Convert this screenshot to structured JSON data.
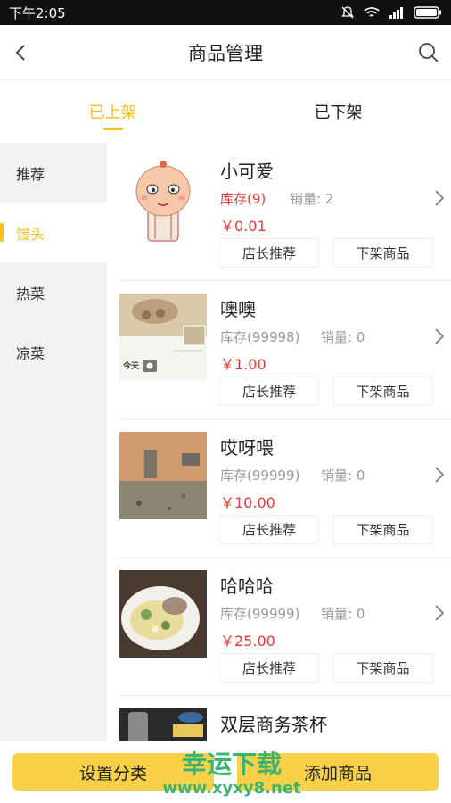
{
  "status": {
    "time": "下午2:05"
  },
  "nav": {
    "title": "商品管理"
  },
  "tabs": [
    {
      "label": "已上架",
      "active": true
    },
    {
      "label": "已下架",
      "active": false
    }
  ],
  "sidebar": {
    "items": [
      {
        "label": "推荐"
      },
      {
        "label": "馒头"
      },
      {
        "label": "热菜"
      },
      {
        "label": "凉菜"
      }
    ]
  },
  "products": [
    {
      "name": "小可爱",
      "stock": "库存(9)",
      "sales": "销量: 2",
      "price": "￥0.01",
      "recommend_label": "店长推荐",
      "offshelf_label": "下架商品"
    },
    {
      "name": "噢噢",
      "stock": "库存(99998)",
      "sales": "销量: 0",
      "price": "￥1.00",
      "recommend_label": "店长推荐",
      "offshelf_label": "下架商品",
      "thumb_text": "今天"
    },
    {
      "name": "哎呀喂",
      "stock": "库存(99999)",
      "sales": "销量: 0",
      "price": "￥10.00",
      "recommend_label": "店长推荐",
      "offshelf_label": "下架商品"
    },
    {
      "name": "哈哈哈",
      "stock": "库存(99999)",
      "sales": "销量: 0",
      "price": "￥25.00",
      "recommend_label": "店长推荐",
      "offshelf_label": "下架商品"
    },
    {
      "name": "双层商务茶杯"
    }
  ],
  "bottom": {
    "set_category": "设置分类",
    "add_product": "添加商品"
  },
  "watermark": {
    "line1": "幸运下载",
    "line2": "www.xyxy8.net"
  },
  "colors": {
    "accent": "#f4c21b",
    "price": "#e53935",
    "button": "#f8d148"
  }
}
